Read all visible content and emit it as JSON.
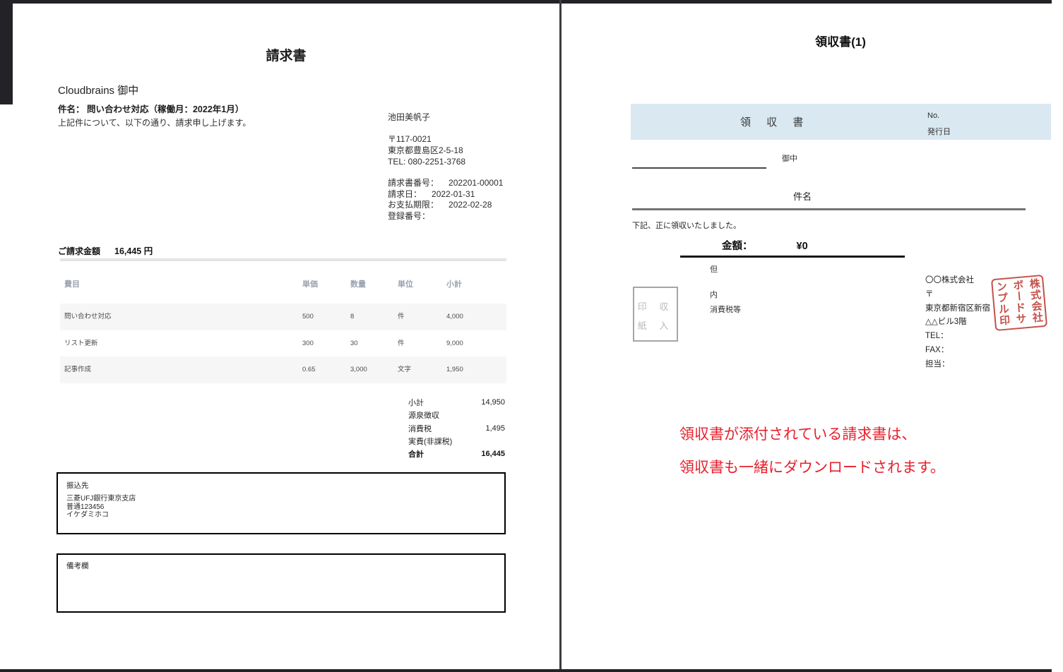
{
  "colors": {
    "banner_blue": "#d9e8f1",
    "note_red": "#e7202c",
    "seal_red": "#c4524a",
    "table_header_gray": "#9aa2b0",
    "frame_dark": "#232327"
  },
  "invoice": {
    "title": "請求書",
    "recipient": "Cloudbrains 御中",
    "subject": "件名： 問い合わせ対応（稼働月：2022年1月）",
    "intro": "上記件について、以下の通り、請求申し上げます。",
    "issuer": {
      "name": "池田美帆子",
      "postal": "〒117-0021",
      "address": "東京都豊島区2-5-18",
      "tel": "TEL: 080-2251-3768"
    },
    "meta": [
      {
        "label": "請求書番号：",
        "value": "202201-00001"
      },
      {
        "label": "請求日：",
        "value": "2022-01-31"
      },
      {
        "label": "お支払期限：",
        "value": "2022-02-28"
      },
      {
        "label": "登録番号：",
        "value": ""
      }
    ],
    "amount_label": "ご請求金額",
    "amount_value": "16,445 円",
    "table": {
      "headers": [
        "費目",
        "単価",
        "数量",
        "単位",
        "小計"
      ],
      "rows": [
        [
          "問い合わせ対応",
          "500",
          "8",
          "件",
          "4,000"
        ],
        [
          "リスト更新",
          "300",
          "30",
          "件",
          "9,000"
        ],
        [
          "記事作成",
          "0.65",
          "3,000",
          "文字",
          "1,950"
        ]
      ]
    },
    "totals": [
      {
        "label": "小計",
        "value": "14,950"
      },
      {
        "label": "源泉徴収",
        "value": ""
      },
      {
        "label": "消費税",
        "value": "1,495"
      },
      {
        "label": "実費(非課税)",
        "value": ""
      },
      {
        "label": "合計",
        "value": "16,445"
      }
    ],
    "bank_box": {
      "label": "振込先",
      "lines": [
        "三菱UFJ銀行東京支店",
        "普通123456",
        "イケダミホコ"
      ]
    },
    "notes_box": {
      "label": "備考欄"
    }
  },
  "receipt": {
    "title": "領収書(1)",
    "banner": {
      "title": "領 収 書",
      "no_label": "No.",
      "issue_date_label": "発行日"
    },
    "addressee_suffix": "御中",
    "subject_label": "件名",
    "statement": "下記、正に領収いたしました。",
    "amount_label": "金額：",
    "amount_value": "¥0",
    "proviso_label": "但",
    "stamp_box": {
      "line1": "印 収",
      "line2": "紙 入"
    },
    "breakdown": {
      "uchi": "内",
      "tax": "消費税等"
    },
    "issuer_lines": [
      "〇〇株式会社",
      "〒",
      "東京都新宿区新宿",
      "△△ビル3階",
      "TEL：",
      "FAX：",
      "担当："
    ],
    "seal": {
      "cols": [
        "株式会社",
        "ボードサ",
        "ンプル印"
      ]
    },
    "note_line1": "領収書が添付されている請求書は、",
    "note_line2": "領収書も一緒にダウンロードされます。"
  }
}
